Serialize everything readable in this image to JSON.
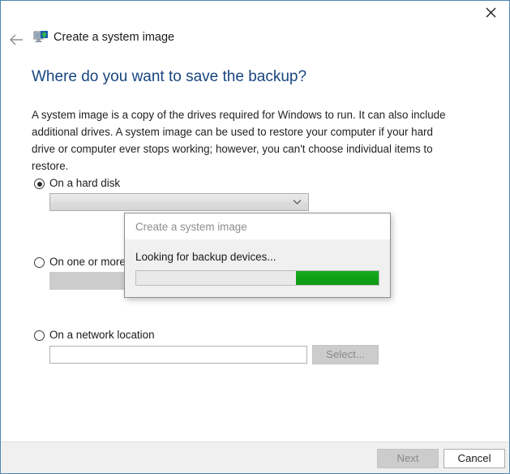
{
  "window": {
    "close_label": "✕",
    "border_color": "#4d87b3"
  },
  "nav": {
    "back_label": "←",
    "title": "Create a system image",
    "icon": "system-image-monitor-icon"
  },
  "page": {
    "heading": "Where do you want to save the backup?",
    "body": "A system image is a copy of the drives required for Windows to run. It can also include additional drives. A system image can be used to restore your computer if your hard drive or computer ever stops working; however, you can't choose individual items to restore.",
    "heading_color": "#17457f"
  },
  "options": {
    "hard_disk": {
      "label": "On a hard disk",
      "selected": true,
      "combo_value": "",
      "combo_placeholder": "",
      "chevron_icon": "chevron-down-icon"
    },
    "dvd": {
      "label": "On one or more D",
      "selected": false,
      "field_value": ""
    },
    "network": {
      "label": "On a network location",
      "selected": false,
      "field_value": "",
      "field_placeholder": "",
      "select_button": "Select..."
    }
  },
  "dialog": {
    "title": "Create a system image",
    "message": "Looking for backup devices...",
    "progress": {
      "style": "marquee",
      "chunk_percent": 34,
      "chunk_color": "#10a017",
      "track_color": "#e9e9e9"
    }
  },
  "footer": {
    "next_label": "Next",
    "next_enabled": false,
    "cancel_label": "Cancel",
    "cancel_enabled": true
  }
}
